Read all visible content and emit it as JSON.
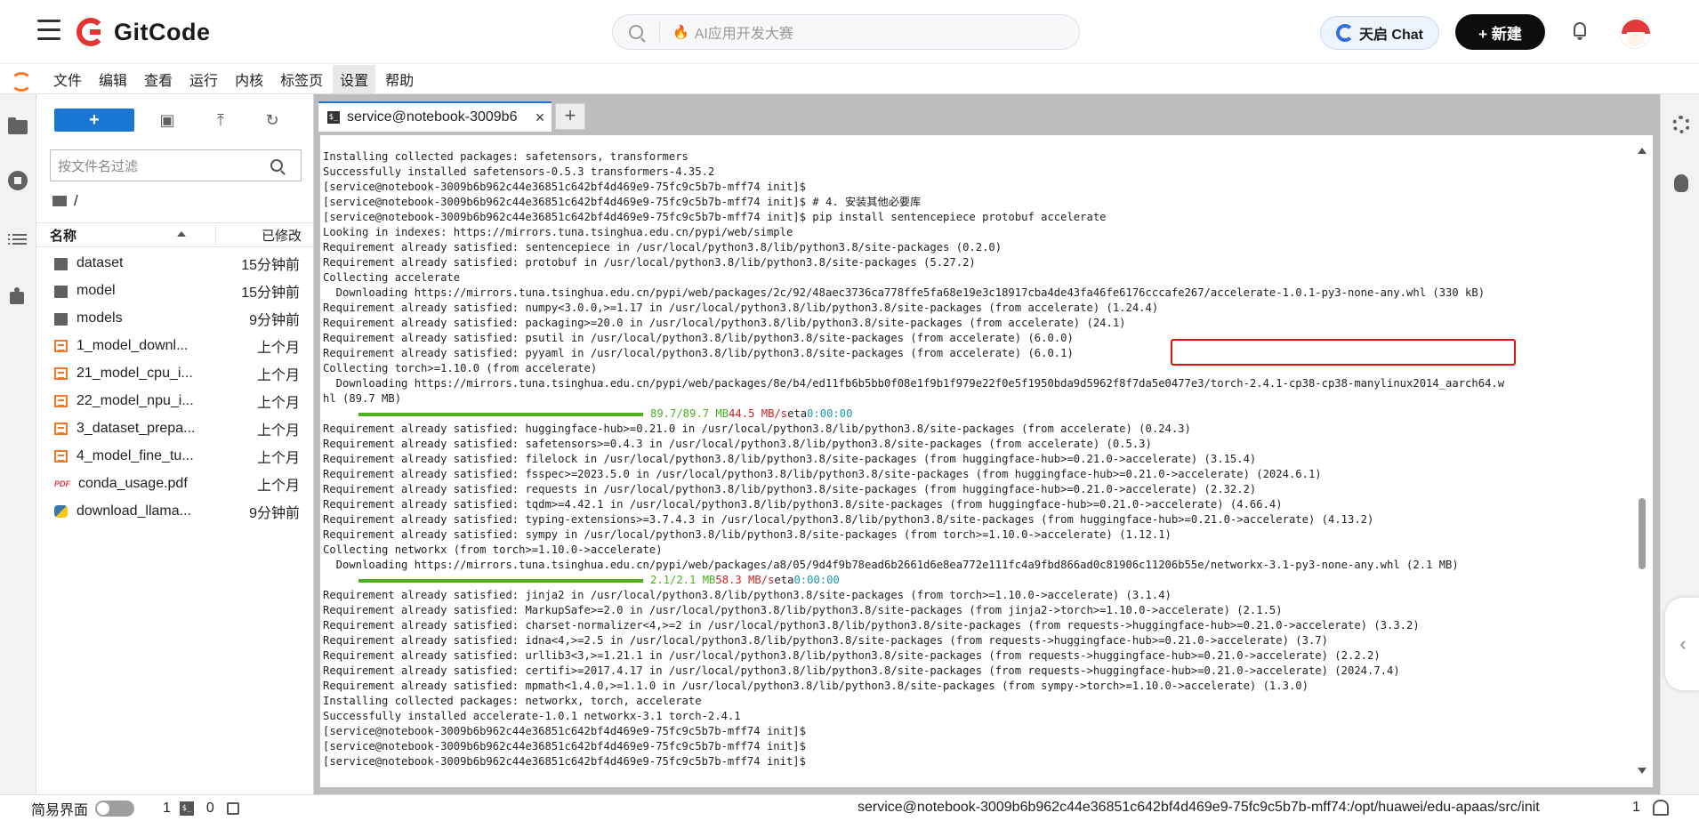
{
  "header": {
    "brand": "GitCode",
    "search_placeholder": "AI应用开发大赛",
    "tianqi_label": "天启 Chat",
    "new_label": "+ 新建"
  },
  "menubar": {
    "items": [
      "文件",
      "编辑",
      "查看",
      "运行",
      "内核",
      "标签页",
      "设置",
      "帮助"
    ],
    "active": "设置"
  },
  "filebrowser": {
    "new_label": "+",
    "filter_placeholder": "按文件名过滤",
    "breadcrumb": "/",
    "col_name": "名称",
    "col_modified": "已修改",
    "files": [
      {
        "name": "dataset",
        "type": "folder",
        "modified": "15分钟前"
      },
      {
        "name": "model",
        "type": "folder",
        "modified": "15分钟前"
      },
      {
        "name": "models",
        "type": "folder",
        "modified": "9分钟前"
      },
      {
        "name": "1_model_downl...",
        "type": "notebook",
        "modified": "上个月"
      },
      {
        "name": "21_model_cpu_i...",
        "type": "notebook",
        "modified": "上个月"
      },
      {
        "name": "22_model_npu_i...",
        "type": "notebook",
        "modified": "上个月"
      },
      {
        "name": "3_dataset_prepa...",
        "type": "notebook",
        "modified": "上个月"
      },
      {
        "name": "4_model_fine_tu...",
        "type": "notebook",
        "modified": "上个月"
      },
      {
        "name": "conda_usage.pdf",
        "type": "pdf",
        "modified": "上个月"
      },
      {
        "name": "download_llama...",
        "type": "python",
        "modified": "9分钟前"
      }
    ]
  },
  "tab": {
    "title": "service@notebook-3009b6",
    "close": "×",
    "add": "+"
  },
  "terminal": {
    "lines_a": [
      "Installing collected packages: safetensors, transformers",
      "Successfully installed safetensors-0.5.3 transformers-4.35.2",
      "[service@notebook-3009b6b962c44e36851c642bf4d469e9-75fc9c5b7b-mff74 init]$",
      "[service@notebook-3009b6b962c44e36851c642bf4d469e9-75fc9c5b7b-mff74 init]$ # 4. 安装其他必要库",
      "[service@notebook-3009b6b962c44e36851c642bf4d469e9-75fc9c5b7b-mff74 init]$ pip install sentencepiece protobuf accelerate",
      "Looking in indexes: https://mirrors.tuna.tsinghua.edu.cn/pypi/web/simple",
      "Requirement already satisfied: sentencepiece in /usr/local/python3.8/lib/python3.8/site-packages (0.2.0)",
      "Requirement already satisfied: protobuf in /usr/local/python3.8/lib/python3.8/site-packages (5.27.2)",
      "Collecting accelerate",
      "  Downloading https://mirrors.tuna.tsinghua.edu.cn/pypi/web/packages/2c/92/48aec3736ca778ffe5fa68e19e3c18917cba4de43fa46fe6176cccafe267/accelerate-1.0.1-py3-none-any.whl (330 kB)",
      "Requirement already satisfied: numpy<3.0.0,>=1.17 in /usr/local/python3.8/lib/python3.8/site-packages (from accelerate) (1.24.4)",
      "Requirement already satisfied: packaging>=20.0 in /usr/local/python3.8/lib/python3.8/site-packages (from accelerate) (24.1)",
      "Requirement already satisfied: psutil in /usr/local/python3.8/lib/python3.8/site-packages (from accelerate) (6.0.0)",
      "Requirement already satisfied: pyyaml in /usr/local/python3.8/lib/python3.8/site-packages (from accelerate) (6.0.1)",
      "Collecting torch>=1.10.0 (from accelerate)",
      "  Downloading https://mirrors.tuna.tsinghua.edu.cn/pypi/web/packages/8e/b4/ed11fb6b5bb0f08e1f9b1f979e22f0e5f1950bda9d5962f8f7da5e0477e3/torch-2.4.1-cp38-cp38-manylinux2014_aarch64.w",
      "hl (89.7 MB)"
    ],
    "progress1": {
      "fraction": 1.0,
      "size": "89.7/89.7 MB",
      "speed": "44.5 MB/s",
      "eta_label": "eta",
      "eta": "0:00:00"
    },
    "lines_b": [
      "Requirement already satisfied: huggingface-hub>=0.21.0 in /usr/local/python3.8/lib/python3.8/site-packages (from accelerate) (0.24.3)",
      "Requirement already satisfied: safetensors>=0.4.3 in /usr/local/python3.8/lib/python3.8/site-packages (from accelerate) (0.5.3)",
      "Requirement already satisfied: filelock in /usr/local/python3.8/lib/python3.8/site-packages (from huggingface-hub>=0.21.0->accelerate) (3.15.4)",
      "Requirement already satisfied: fsspec>=2023.5.0 in /usr/local/python3.8/lib/python3.8/site-packages (from huggingface-hub>=0.21.0->accelerate) (2024.6.1)",
      "Requirement already satisfied: requests in /usr/local/python3.8/lib/python3.8/site-packages (from huggingface-hub>=0.21.0->accelerate) (2.32.2)",
      "Requirement already satisfied: tqdm>=4.42.1 in /usr/local/python3.8/lib/python3.8/site-packages (from huggingface-hub>=0.21.0->accelerate) (4.66.4)",
      "Requirement already satisfied: typing-extensions>=3.7.4.3 in /usr/local/python3.8/lib/python3.8/site-packages (from huggingface-hub>=0.21.0->accelerate) (4.13.2)",
      "Requirement already satisfied: sympy in /usr/local/python3.8/lib/python3.8/site-packages (from torch>=1.10.0->accelerate) (1.12.1)",
      "Collecting networkx (from torch>=1.10.0->accelerate)",
      "  Downloading https://mirrors.tuna.tsinghua.edu.cn/pypi/web/packages/a8/05/9d4f9b78ead6b2661d6e8ea772e111fc4a9fbd866ad0c81906c11206b55e/networkx-3.1-py3-none-any.whl (2.1 MB)"
    ],
    "progress2": {
      "fraction": 1.0,
      "size": "2.1/2.1 MB",
      "speed": "58.3 MB/s",
      "eta_label": "eta",
      "eta": "0:00:00"
    },
    "lines_c": [
      "Requirement already satisfied: jinja2 in /usr/local/python3.8/lib/python3.8/site-packages (from torch>=1.10.0->accelerate) (3.1.4)",
      "Requirement already satisfied: MarkupSafe>=2.0 in /usr/local/python3.8/lib/python3.8/site-packages (from jinja2->torch>=1.10.0->accelerate) (2.1.5)",
      "Requirement already satisfied: charset-normalizer<4,>=2 in /usr/local/python3.8/lib/python3.8/site-packages (from requests->huggingface-hub>=0.21.0->accelerate) (3.3.2)",
      "Requirement already satisfied: idna<4,>=2.5 in /usr/local/python3.8/lib/python3.8/site-packages (from requests->huggingface-hub>=0.21.0->accelerate) (3.7)",
      "Requirement already satisfied: urllib3<3,>=1.21.1 in /usr/local/python3.8/lib/python3.8/site-packages (from requests->huggingface-hub>=0.21.0->accelerate) (2.2.2)",
      "Requirement already satisfied: certifi>=2017.4.17 in /usr/local/python3.8/lib/python3.8/site-packages (from requests->huggingface-hub>=0.21.0->accelerate) (2024.7.4)",
      "Requirement already satisfied: mpmath<1.4.0,>=1.1.0 in /usr/local/python3.8/lib/python3.8/site-packages (from sympy->torch>=1.10.0->accelerate) (1.3.0)",
      "Installing collected packages: networkx, torch, accelerate",
      "Successfully installed accelerate-1.0.1 networkx-3.1 torch-2.4.1",
      "[service@notebook-3009b6b962c44e36851c642bf4d469e9-75fc9c5b7b-mff74 init]$",
      "[service@notebook-3009b6b962c44e36851c642bf4d469e9-75fc9c5b7b-mff74 init]$",
      "[service@notebook-3009b6b962c44e36851c642bf4d469e9-75fc9c5b7b-mff74 init]$"
    ]
  },
  "statusbar": {
    "simple_mode": "简易界面",
    "count1": "1",
    "count2": "0",
    "path": "service@notebook-3009b6b962c44e36851c642bf4d469e9-75fc9c5b7b-mff74:/opt/huawei/edu-apaas/src/init",
    "count3": "1"
  },
  "colors": {
    "accent": "#1976d2",
    "highlight_box": "#e01010",
    "progress": "#4caf1e",
    "speed": "#d11e1e",
    "eta": "#1a9aa8"
  }
}
